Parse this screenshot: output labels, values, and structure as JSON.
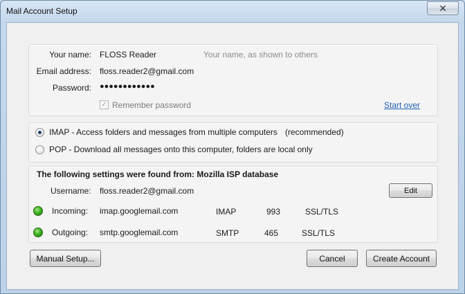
{
  "window": {
    "title": "Mail Account Setup",
    "close_symbol": "✕"
  },
  "identity": {
    "name_label": "Your name:",
    "name_value": "FLOSS Reader",
    "name_hint": "Your name, as shown to others",
    "email_label": "Email address:",
    "email_value": "floss.reader2@gmail.com",
    "password_label": "Password:",
    "password_value": "●●●●●●●●●●●●",
    "remember_label": "Remember password",
    "remember_checked": true,
    "start_over": "Start over"
  },
  "protocol": {
    "imap_label": "IMAP - Access folders and messages from multiple computers",
    "imap_note": "(recommended)",
    "pop_label": "POP - Download all messages onto this computer, folders are local only",
    "selected": "IMAP"
  },
  "settings": {
    "heading": "The following settings were found from: Mozilla ISP database",
    "username_label": "Username:",
    "username_value": "floss.reader2@gmail.com",
    "edit_button": "Edit",
    "incoming": {
      "label": "Incoming:",
      "server": "imap.googlemail.com",
      "protocol": "IMAP",
      "port": "993",
      "security": "SSL/TLS",
      "status_color": "#3bb21f"
    },
    "outgoing": {
      "label": "Outgoing:",
      "server": "smtp.googlemail.com",
      "protocol": "SMTP",
      "port": "465",
      "security": "SSL/TLS",
      "status_color": "#3bb21f"
    }
  },
  "buttons": {
    "manual_setup": "Manual Setup...",
    "cancel": "Cancel",
    "create_account": "Create Account"
  }
}
